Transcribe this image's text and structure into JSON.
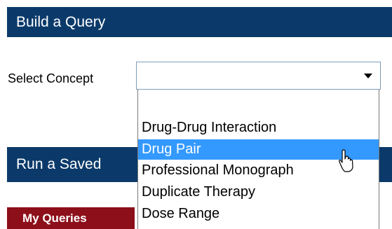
{
  "build_section": {
    "title": "Build a Query"
  },
  "concept": {
    "label": "Select Concept",
    "selected_value": "",
    "options": [
      "Drug-Drug Interaction",
      "Drug Pair",
      "Professional Monograph",
      "Duplicate Therapy",
      "Dose Range"
    ],
    "highlighted_option": "Drug Pair"
  },
  "run_section": {
    "title": "Run a Saved"
  },
  "tabs": {
    "my_queries": "My Queries"
  },
  "colors": {
    "section_bar": "#0b3a6a",
    "highlight": "#3399ff",
    "tab_active": "#8c0f1a"
  },
  "icons": {
    "cursor": "hand-pointer-icon",
    "dropdown": "chevron-down-icon"
  }
}
